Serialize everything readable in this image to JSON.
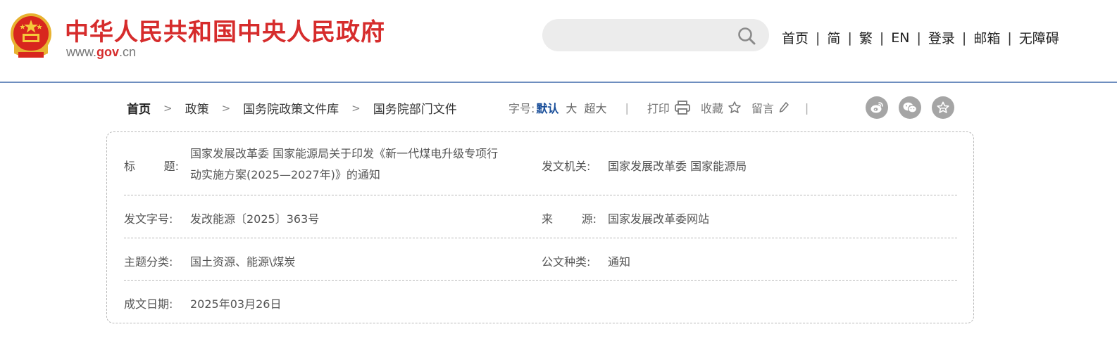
{
  "header": {
    "site_title": "中华人民共和国中央人民政府",
    "site_url_prefix": "www.",
    "site_url_gov": "gov",
    "site_url_suffix": ".cn",
    "search": {
      "value": "",
      "placeholder": ""
    },
    "nav": [
      {
        "label": "首页"
      },
      {
        "label": "简"
      },
      {
        "label": "繁"
      },
      {
        "label": "EN"
      },
      {
        "label": "登录"
      },
      {
        "label": "邮箱"
      },
      {
        "label": "无障碍"
      }
    ],
    "nav_separator": "|"
  },
  "breadcrumb": {
    "items": [
      "首页",
      "政策",
      "国务院政策文件库",
      "国务院部门文件"
    ],
    "arrow": ">"
  },
  "toolbar": {
    "font_size_label": "字号:",
    "font_default": "默认",
    "font_large": "大",
    "font_xlarge": "超大",
    "separator": "|",
    "print_label": "打印",
    "favorite_label": "收藏",
    "comment_label": "留言"
  },
  "share_icons": [
    "weibo-icon",
    "wechat-icon",
    "favorite-star-icon"
  ],
  "info": {
    "title_label_1": "标",
    "title_label_2": "题:",
    "title_value_line1": "国家发展改革委 国家能源局关于印发《新一代煤电升级专项行",
    "title_value_line2": "动实施方案(2025—2027年)》的通知",
    "issuer_label": "发文机关:",
    "issuer_value": "国家发展改革委 国家能源局",
    "doc_no_label": "发文字号:",
    "doc_no_value": "发改能源〔2025〕363号",
    "source_label_1": "来",
    "source_label_2": "源:",
    "source_value": "国家发展改革委网站",
    "topic_label": "主题分类:",
    "topic_value": "国土资源、能源\\煤炭",
    "doc_type_label": "公文种类:",
    "doc_type_value": "通知",
    "date_label": "成文日期:",
    "date_value": "2025年03月26日"
  },
  "colors": {
    "brand_red": "#d62c2c",
    "header_rule": "#6e8ebf",
    "accent_blue": "#1a4f9a",
    "icon_gray": "#a5a5a5"
  }
}
